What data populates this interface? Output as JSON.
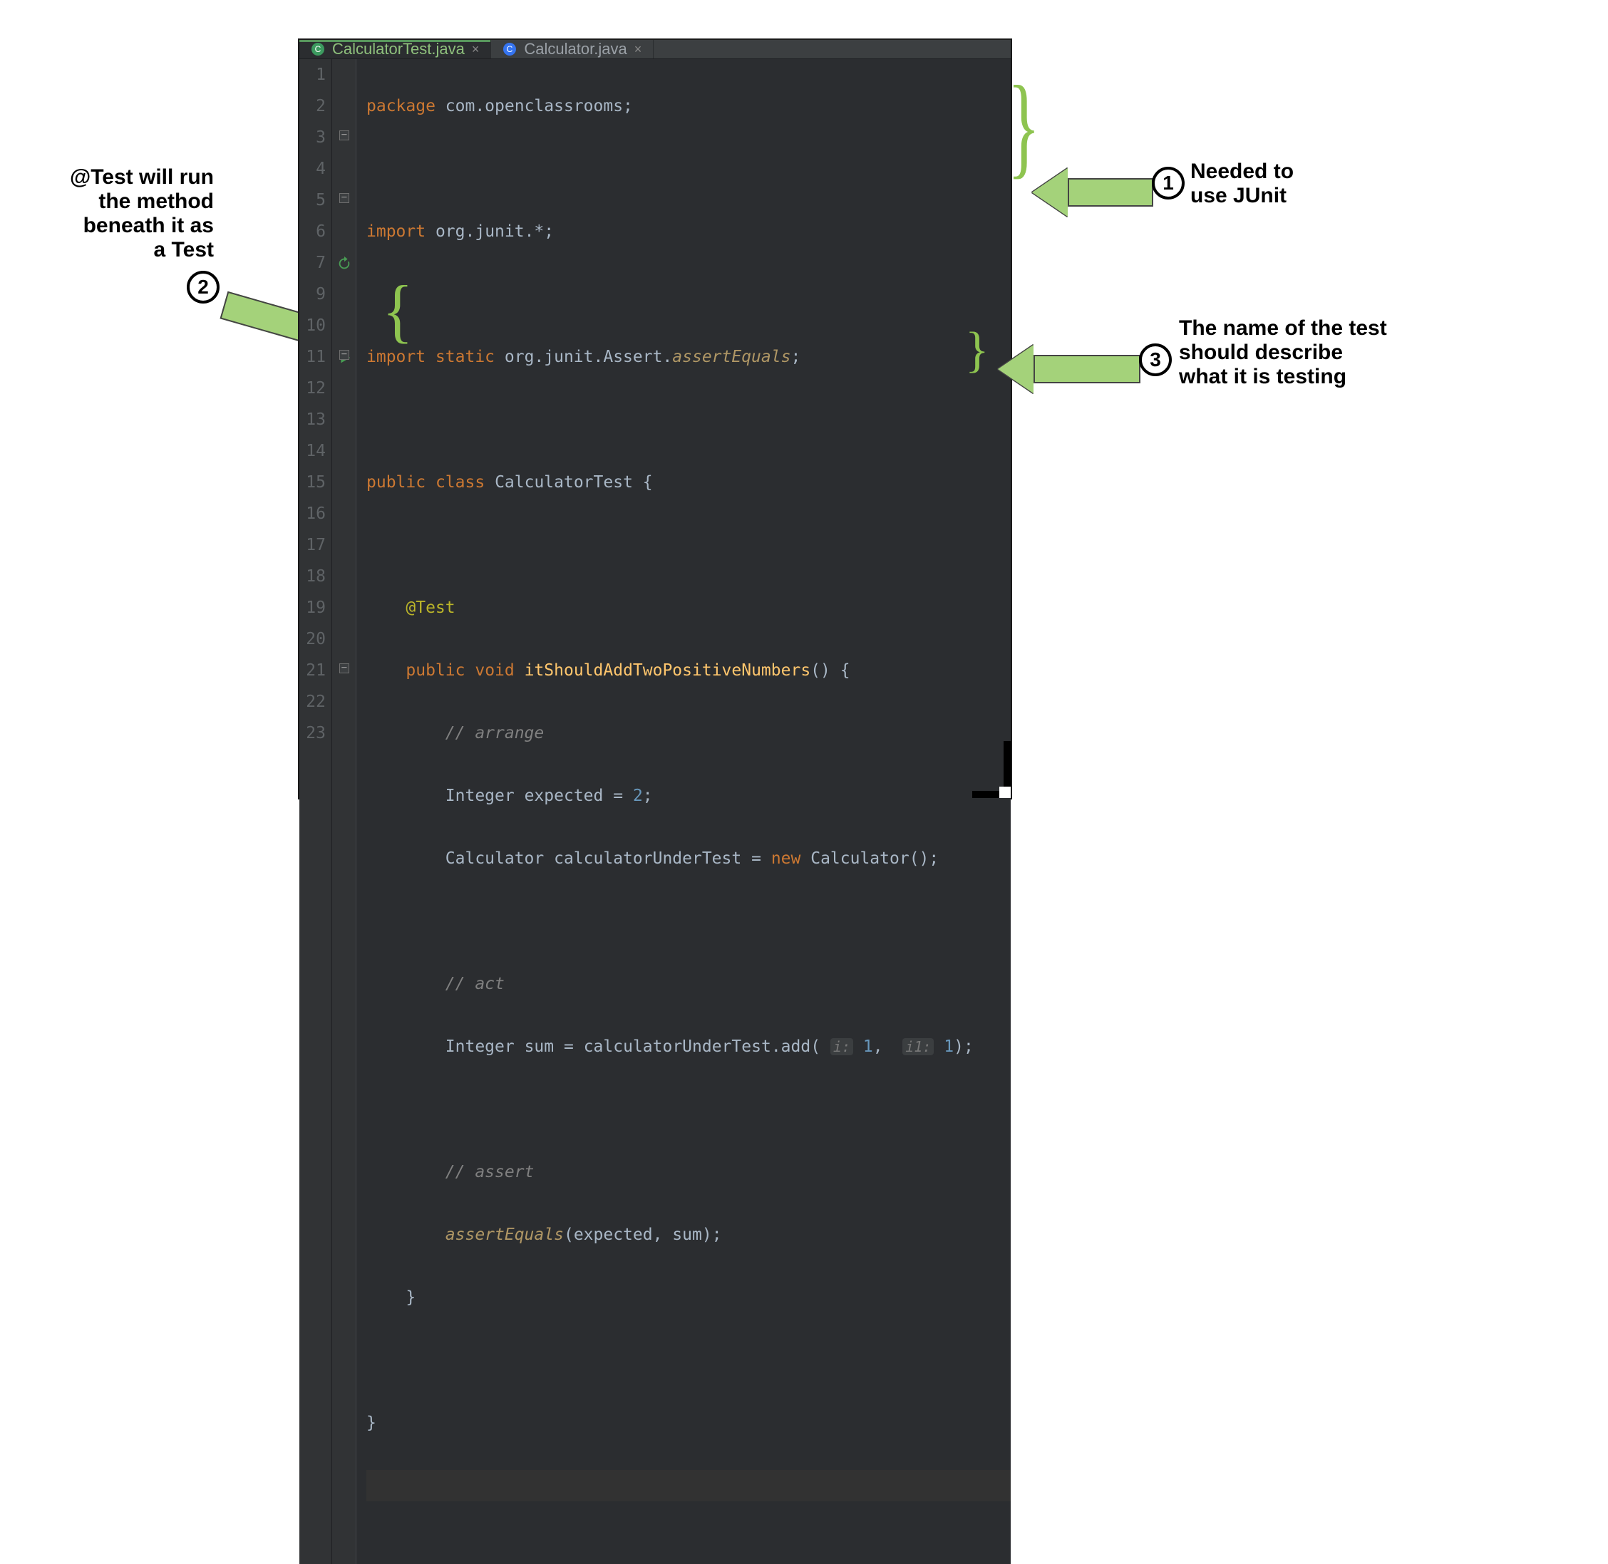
{
  "tabs": [
    {
      "label": "CalculatorTest.java",
      "active": true
    },
    {
      "label": "Calculator.java",
      "active": false
    }
  ],
  "line_numbers": [
    "1",
    "2",
    "3",
    "4",
    "5",
    "6",
    "7",
    "",
    "9",
    "10",
    "11",
    "12",
    "13",
    "14",
    "15",
    "16",
    "17",
    "18",
    "19",
    "20",
    "21",
    "22",
    "23"
  ],
  "code": {
    "l1_package_kw": "package",
    "l1_package_name": "com.openclassrooms",
    "l3_import_kw": "import",
    "l3_import_name": "org.junit.*",
    "l5_import_kw": "import static",
    "l5_import_name_pre": "org.junit.Assert.",
    "l5_import_fn": "assertEquals",
    "l7_public": "public",
    "l7_class": "class",
    "l7_classname": "CalculatorTest",
    "l9_ann": "@Test",
    "l10_public": "public",
    "l10_void": "void",
    "l10_fn": "itShouldAddTwoPositiveNumbers",
    "l11_cmt": "// arrange",
    "l12_type": "Integer",
    "l12_var": "expected",
    "l12_val": "2",
    "l13_type": "Calculator",
    "l13_var": "calculatorUnderTest",
    "l13_new": "new",
    "l13_ctor": "Calculator",
    "l15_cmt": "// act",
    "l16_type": "Integer",
    "l16_var": "sum",
    "l16_obj": "calculatorUnderTest",
    "l16_method": "add",
    "l16_h1": "i:",
    "l16_a1": "1",
    "l16_h2": "i1:",
    "l16_a2": "1",
    "l18_cmt": "// assert",
    "l19_fn": "assertEquals",
    "l19_a1": "expected",
    "l19_a2": "sum"
  },
  "callouts": {
    "c1_badge": "1",
    "c1_text_l1": "Needed to",
    "c1_text_l2": "use JUnit",
    "c2_badge": "2",
    "c2_text_l1": "@Test will run",
    "c2_text_l2": "the method",
    "c2_text_l3": "beneath it as",
    "c2_text_l4": "a Test",
    "c3_badge": "3",
    "c3_text_l1": "The name of the test",
    "c3_text_l2": "should describe",
    "c3_text_l3": "what it is testing"
  },
  "colors": {
    "editor_bg": "#2b2d30",
    "tabbar_bg": "#3c3f41",
    "arrow_fill": "#a4d27a",
    "brace_green": "#8ec450"
  }
}
